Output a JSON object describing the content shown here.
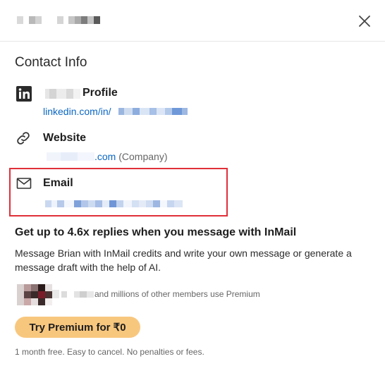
{
  "colors": {
    "link": "#0a66c2",
    "highlight_border": "#e0303a",
    "premium_button_bg": "#f8c77e",
    "muted_text": "#666666"
  },
  "header": {
    "title_redacted": true,
    "close_icon": "close-icon"
  },
  "section_title": "Contact Info",
  "profile": {
    "icon": "linkedin-icon",
    "label": "Profile",
    "url_prefix": "linkedin.com/in/"
  },
  "website": {
    "icon": "link-icon",
    "label": "Website",
    "domain_suffix": ".com",
    "type": "(Company)"
  },
  "email": {
    "icon": "envelope-icon",
    "label": "Email"
  },
  "cta": {
    "headline": "Get up to 4.6x replies when you message with InMail",
    "body": "Message Brian with InMail credits and write your own message or generate a message draft with the help of AI.",
    "members_text": "and millions of other members use Premium",
    "button_label": "Try Premium for ₹0",
    "footnote": "1 month free. Easy to cancel. No penalties or fees."
  }
}
